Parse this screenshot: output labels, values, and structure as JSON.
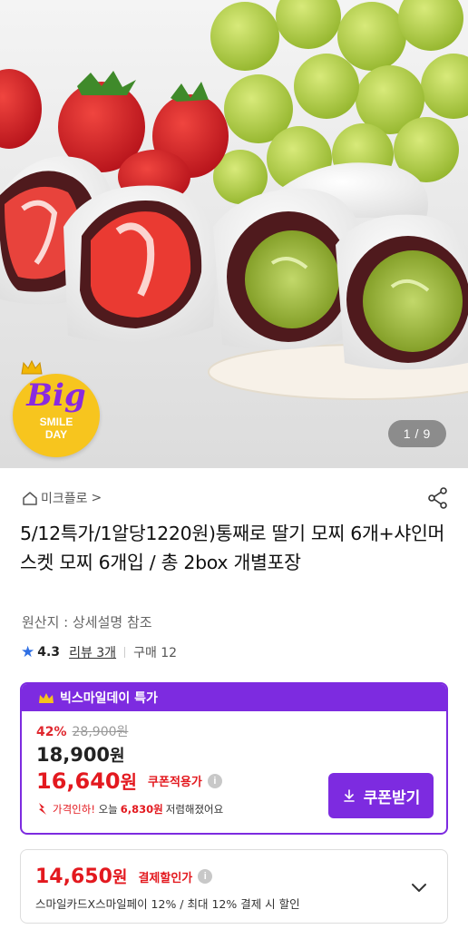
{
  "hero": {
    "counter_current": "1",
    "counter_sep": "/",
    "counter_total": "9",
    "badge_big": "Big",
    "badge_line1": "SMILE",
    "badge_line2": "DAY"
  },
  "product": {
    "brand": "미크플로",
    "brand_chevron": ">",
    "title": "5/12특가/1알당1220원)통째로 딸기 모찌 6개+샤인머스켓 모찌 6개입 / 총 2box 개별포장",
    "origin": "원산지 : 상세설명 참조",
    "rating_score": "4.3",
    "reviews": "리뷰 3개",
    "purchases": "구매 12"
  },
  "deal": {
    "header": "빅스마일데이 특가",
    "discount_pct": "42%",
    "original_price": "28,900원",
    "price_amount": "18,900",
    "price_unit": "원",
    "coupon_amount": "16,640",
    "coupon_unit": "원",
    "coupon_label": "쿠폰적용가",
    "drop_prefix": "가격인하!",
    "drop_text1": "오늘",
    "drop_amount": "6,830원",
    "drop_text2": "저렴해졌어요",
    "coupon_button": "쿠폰받기"
  },
  "payment": {
    "amount": "14,650",
    "unit": "원",
    "label": "결제할인가",
    "sub": "스마일카드X스마일페이 12% / 최대 12% 결제 시 할인"
  },
  "colors": {
    "accent_purple": "#7d2be0",
    "price_red": "#e3191f",
    "rating_blue": "#2f6fe4"
  },
  "icons": {
    "brand": "home-icon",
    "share": "share-icon",
    "rating": "star-icon",
    "info": "info-icon",
    "download": "download-icon",
    "expand": "chevron-down-icon"
  }
}
